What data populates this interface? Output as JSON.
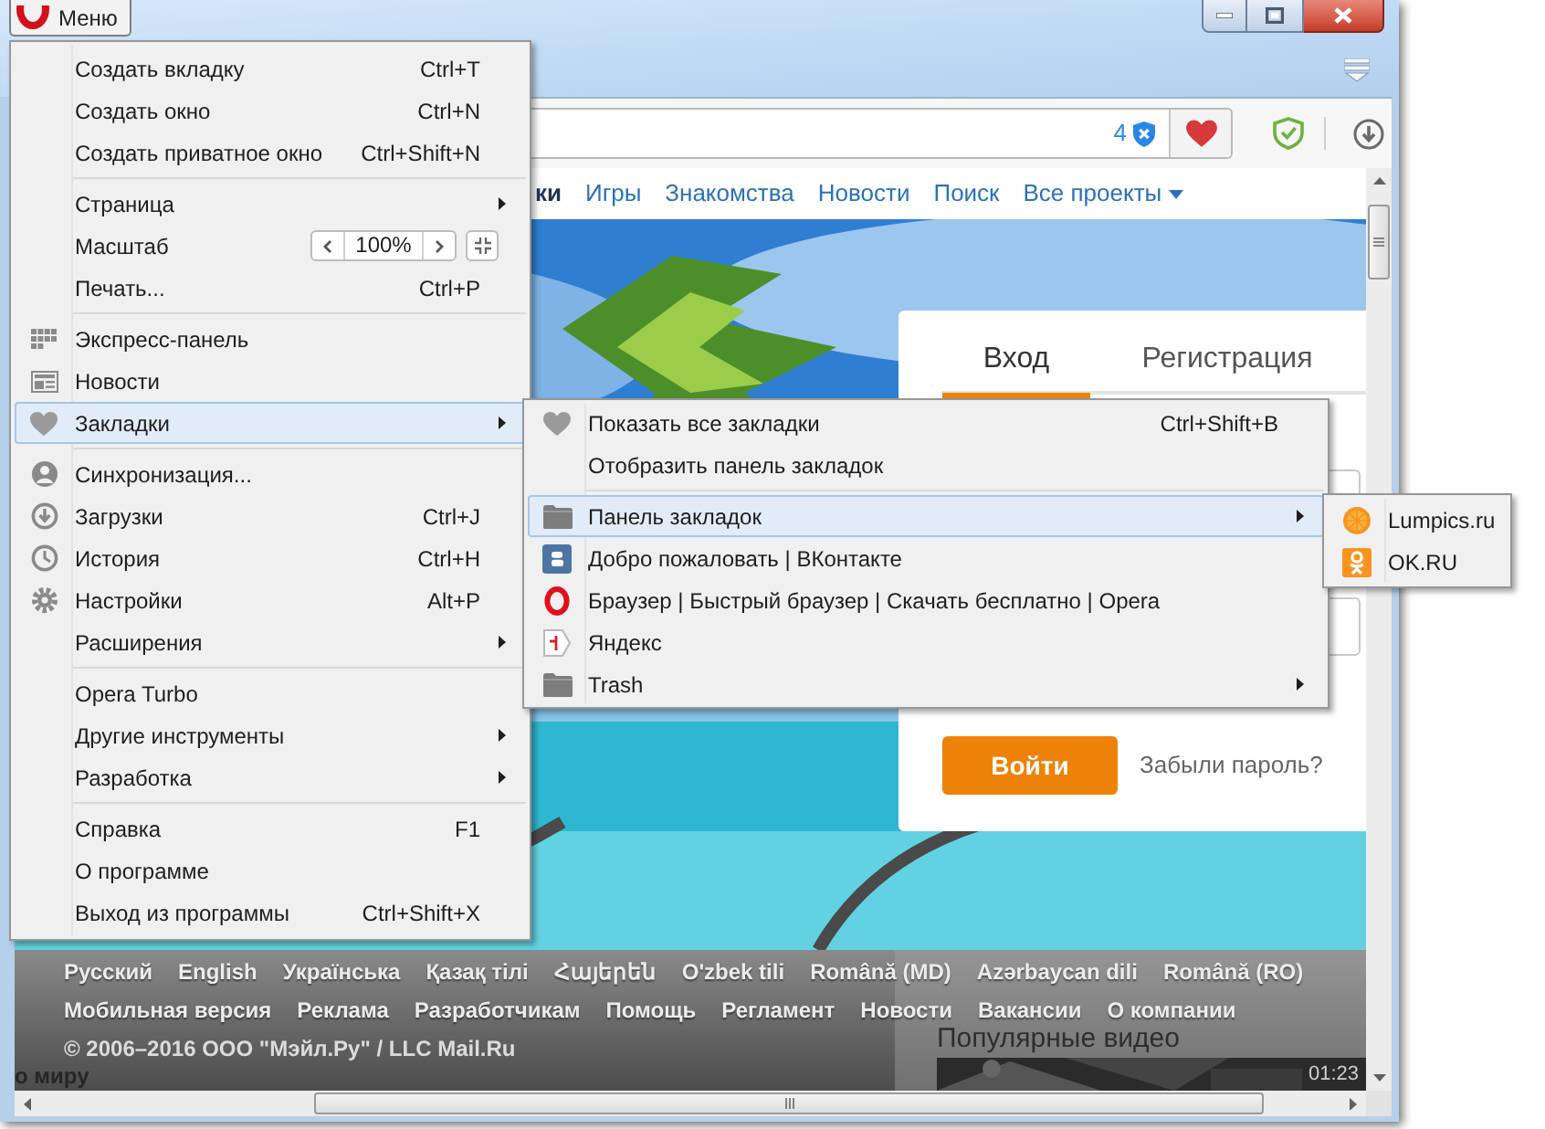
{
  "menu_button": {
    "label": "Меню"
  },
  "address_bar": {
    "blocked_count": "4"
  },
  "nav_links": [
    {
      "label": "ки",
      "selected": true
    },
    {
      "label": "Игры",
      "selected": false
    },
    {
      "label": "Знакомства",
      "selected": false
    },
    {
      "label": "Новости",
      "selected": false
    },
    {
      "label": "Поиск",
      "selected": false
    },
    {
      "label": "Все проекты",
      "selected": false
    }
  ],
  "login_card": {
    "tabs": [
      {
        "label": "Вход",
        "selected": true
      },
      {
        "label": "Регистрация",
        "selected": false
      }
    ],
    "submit_button": "Войти",
    "forgot_link": "Забыли пароль?"
  },
  "footer": {
    "languages": [
      "Русский",
      "English",
      "Українська",
      "Қазақ тілі",
      "Հայերեն",
      "O'zbek tili",
      "Română (MD)",
      "Azərbaycan dili",
      "Română (RO)"
    ],
    "links": [
      "Мобильная версия",
      "Реклама",
      "Разработчикам",
      "Помощь",
      "Регламент",
      "Новости",
      "Вакансии",
      "О компании"
    ],
    "copyright": "© 2006–2016 ООО \"Мэйл.Ру\" / LLC Mail.Ru",
    "cut_heading": "о миру"
  },
  "popular_videos": {
    "title": "Популярные видео",
    "duration": "01:23"
  },
  "main_menu": {
    "items": [
      {
        "kind": "item",
        "label": "Создать вкладку",
        "shortcut": "Ctrl+T",
        "submenu": false,
        "highlighted": false,
        "separator_before": false
      },
      {
        "kind": "item",
        "label": "Создать окно",
        "shortcut": "Ctrl+N",
        "submenu": false,
        "highlighted": false,
        "separator_before": false
      },
      {
        "kind": "item",
        "label": "Создать приватное окно",
        "shortcut": "Ctrl+Shift+N",
        "submenu": false,
        "highlighted": false,
        "separator_before": false
      },
      {
        "kind": "item",
        "label": "Страница",
        "submenu": true,
        "highlighted": false,
        "separator_before": true
      },
      {
        "kind": "zoom",
        "label": "Масштаб",
        "value": "100%",
        "submenu": false,
        "highlighted": false,
        "separator_before": false
      },
      {
        "kind": "item",
        "label": "Печать...",
        "shortcut": "Ctrl+P",
        "submenu": false,
        "highlighted": false,
        "separator_before": false
      },
      {
        "kind": "item",
        "label": "Экспресс-панель",
        "submenu": false,
        "highlighted": false,
        "separator_before": true
      },
      {
        "kind": "item",
        "label": "Новости",
        "submenu": false,
        "highlighted": false,
        "separator_before": false
      },
      {
        "kind": "item",
        "label": "Закладки",
        "submenu": true,
        "highlighted": true,
        "separator_before": false
      },
      {
        "kind": "item",
        "label": "Синхронизация...",
        "submenu": false,
        "highlighted": false,
        "separator_before": true
      },
      {
        "kind": "item",
        "label": "Загрузки",
        "shortcut": "Ctrl+J",
        "submenu": false,
        "highlighted": false,
        "separator_before": false
      },
      {
        "kind": "item",
        "label": "История",
        "shortcut": "Ctrl+H",
        "submenu": false,
        "highlighted": false,
        "separator_before": false
      },
      {
        "kind": "item",
        "label": "Настройки",
        "shortcut": "Alt+P",
        "submenu": false,
        "highlighted": false,
        "separator_before": false
      },
      {
        "kind": "item",
        "label": "Расширения",
        "submenu": true,
        "highlighted": false,
        "separator_before": false
      },
      {
        "kind": "item",
        "label": "Opera Turbo",
        "submenu": false,
        "highlighted": false,
        "separator_before": true
      },
      {
        "kind": "item",
        "label": "Другие инструменты",
        "submenu": true,
        "highlighted": false,
        "separator_before": false
      },
      {
        "kind": "item",
        "label": "Разработка",
        "submenu": true,
        "highlighted": false,
        "separator_before": false
      },
      {
        "kind": "item",
        "label": "Справка",
        "shortcut": "F1",
        "submenu": false,
        "highlighted": false,
        "separator_before": true
      },
      {
        "kind": "item",
        "label": "О программе",
        "submenu": false,
        "highlighted": false,
        "separator_before": false
      },
      {
        "kind": "item",
        "label": "Выход из программы",
        "shortcut": "Ctrl+Shift+X",
        "submenu": false,
        "highlighted": false,
        "separator_before": false
      }
    ]
  },
  "bookmarks_menu": {
    "items": [
      {
        "kind": "item",
        "label": "Показать все закладки",
        "shortcut": "Ctrl+Shift+B",
        "submenu": false,
        "highlighted": false,
        "separator_before": false
      },
      {
        "kind": "item",
        "label": "Отобразить панель закладок",
        "submenu": false,
        "highlighted": false,
        "separator_before": false
      },
      {
        "kind": "item",
        "label": "Панель закладок",
        "submenu": true,
        "highlighted": true,
        "separator_before": true
      },
      {
        "kind": "item",
        "label": "Добро пожаловать | ВКонтакте",
        "submenu": false,
        "highlighted": false,
        "separator_before": false
      },
      {
        "kind": "item",
        "label": "Браузер | Быстрый браузер | Скачать бесплатно | Opera",
        "submenu": false,
        "highlighted": false,
        "separator_before": false
      },
      {
        "kind": "item",
        "label": "Яндекс",
        "submenu": false,
        "highlighted": false,
        "separator_before": false
      },
      {
        "kind": "item",
        "label": "Trash",
        "submenu": true,
        "highlighted": false,
        "separator_before": false
      }
    ]
  },
  "bookmarks_bar_menu": {
    "items": [
      {
        "kind": "item",
        "label": "Lumpics.ru",
        "submenu": false,
        "highlighted": false,
        "separator_before": false
      },
      {
        "kind": "item",
        "label": "OK.RU",
        "submenu": false,
        "highlighted": false,
        "separator_before": false
      }
    ]
  }
}
